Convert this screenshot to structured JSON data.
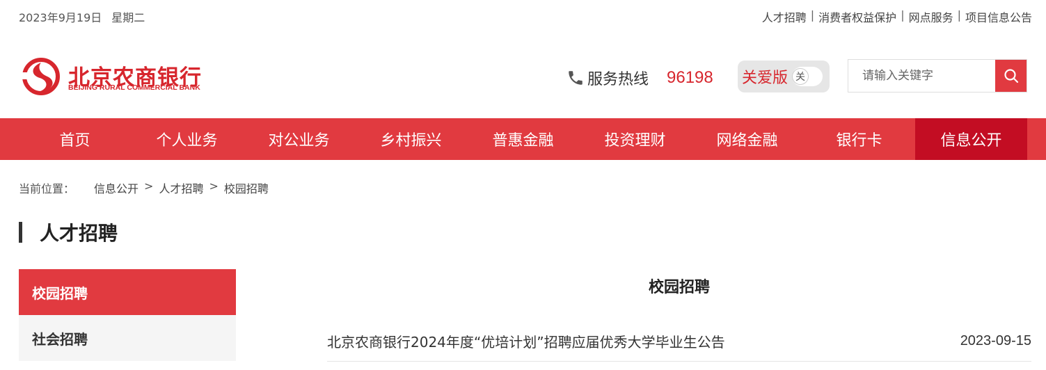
{
  "topbar": {
    "date": "2023年9月19日",
    "weekday": "星期二",
    "links": [
      "人才招聘",
      "消费者权益保护",
      "网点服务",
      "项目信息公告"
    ],
    "separator": "|"
  },
  "logo": {
    "name_cn": "北京农商银行",
    "name_en": "BEIJING RURAL COMMERCIAL BANK"
  },
  "hotline": {
    "icon": "phone-icon",
    "label": "服务热线",
    "number": "96198"
  },
  "care_mode": {
    "label": "关爱版",
    "toggle_text": "关"
  },
  "search": {
    "placeholder": "请输入关键字",
    "icon": "search-icon"
  },
  "nav": {
    "items": [
      "首页",
      "个人业务",
      "对公业务",
      "乡村振兴",
      "普惠金融",
      "投资理财",
      "网络金融",
      "银行卡",
      "信息公开"
    ],
    "active_index": 8
  },
  "breadcrumb": {
    "prefix": "当前位置：",
    "items": [
      "信息公开",
      "人才招聘",
      "校园招聘"
    ],
    "separator": ">"
  },
  "section": {
    "title": "人才招聘"
  },
  "sidebar": {
    "items": [
      "校园招聘",
      "社会招聘"
    ],
    "active_index": 0
  },
  "content": {
    "title": "校园招聘",
    "articles": [
      {
        "title": "北京农商银行2024年度“优培计划”招聘应届优秀大学毕业生公告",
        "date": "2023-09-15"
      }
    ]
  },
  "colors": {
    "brand_red": "#e13a40",
    "active_red": "#c30d23",
    "logo_red": "#d7262d"
  }
}
